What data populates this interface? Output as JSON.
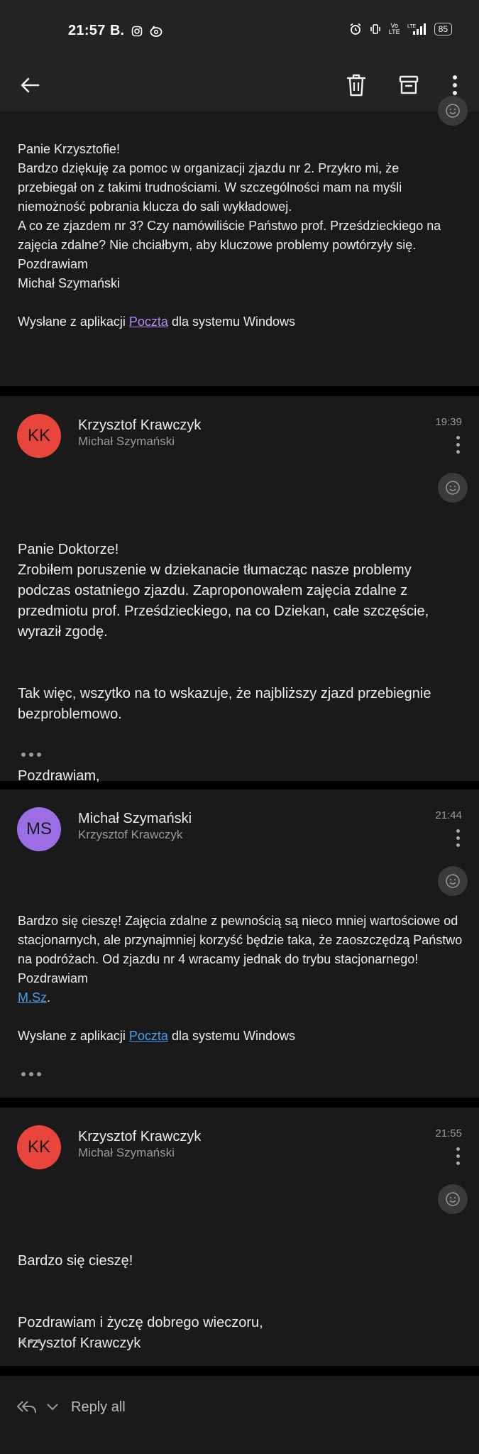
{
  "status_bar": {
    "time": "21:57",
    "left_icons": [
      "b-dot-icon",
      "instagram-icon",
      "camera-ring-icon"
    ],
    "battery": "85"
  },
  "toolbar": {
    "back_icon": "back-arrow-icon",
    "delete_icon": "trash-icon",
    "archive_icon": "archive-icon",
    "more_icon": "more-vert-icon"
  },
  "messages": [
    {
      "lines": [
        "Panie Krzysztofie!",
        "Bardzo dziękuję za pomoc w organizacji zjazdu nr 2. Przykro mi, że przebiegał on z takimi trudnościami. W szczególności mam na myśli niemożność pobrania klucza do sali wykładowej.",
        "A co ze zjazdem nr 3? Czy namówiliście Państwo prof. Prześdzieckiego na zajęcia zdalne? Nie chciałbym, aby kluczowe problemy powtórzyły się.",
        "Pozdrawiam",
        "Michał Szymański"
      ],
      "signature_prefix": "Wysłane z aplikacji ",
      "signature_link": "Poczta",
      "signature_suffix": " dla systemu Windows"
    },
    {
      "avatar": "KK",
      "avatar_color": "#e8453c",
      "sender": "Krzysztof Krawczyk",
      "recipient": "Michał Szymański",
      "time": "19:39",
      "paragraphs": [
        "Panie Doktorze!\nZrobiłem poruszenie w dziekanacie tłumacząc nasze problemy podczas ostatniego zjazdu. Zaproponowałem zajęcia zdalne z przedmiotu prof. Prześdzieckiego, na co Dziekan, całe szczęście, wyraził zgodę.",
        "Tak więc, wszytko na to wskazuje, że najbliższy zjazd przebiegnie bezproblemowo.",
        "Pozdrawiam,\nKrzysztof Krawczyk"
      ]
    },
    {
      "avatar": "MS",
      "avatar_color": "#9c6ee6",
      "sender": "Michał Szymański",
      "recipient": "Krzysztof Krawczyk",
      "time": "21:44",
      "text": "Bardzo się cieszę! Zajęcia zdalne z pewnością są nieco mniej wartościowe od stacjonarnych, ale przynajmniej korzyść będzie taka, że zaoszczędzą Państwo na podróżach. Od zjazdu nr 4 wracamy jednak do trybu stacjonarnego!",
      "closing": "Pozdrawiam",
      "signoff_link": "M.Sz",
      "signoff_suffix": ".",
      "signature_prefix": "Wysłane z aplikacji ",
      "signature_link": "Poczta",
      "signature_suffix": " dla systemu Windows"
    },
    {
      "avatar": "KK",
      "avatar_color": "#e8453c",
      "sender": "Krzysztof Krawczyk",
      "recipient": "Michał Szymański",
      "time": "21:55",
      "paragraphs": [
        "Bardzo się cieszę!",
        "Pozdrawiam i życzę dobrego wieczoru,\nKrzysztof Krawczyk"
      ]
    }
  ],
  "reply_bar": {
    "label": "Reply all"
  }
}
